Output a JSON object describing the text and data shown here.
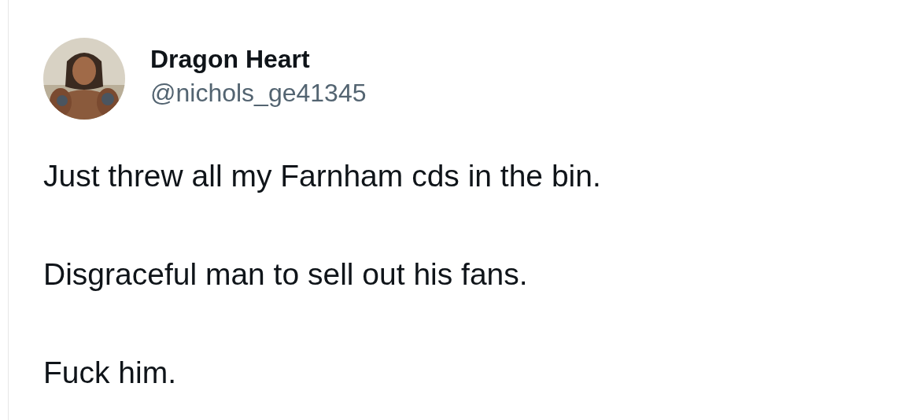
{
  "author": {
    "name": "Dragon Heart",
    "handle": "@nichols_ge41345"
  },
  "paragraphs": [
    "Just threw all my Farnham cds in the bin.",
    "Disgraceful man to sell out his fans.",
    "Fuck him."
  ]
}
